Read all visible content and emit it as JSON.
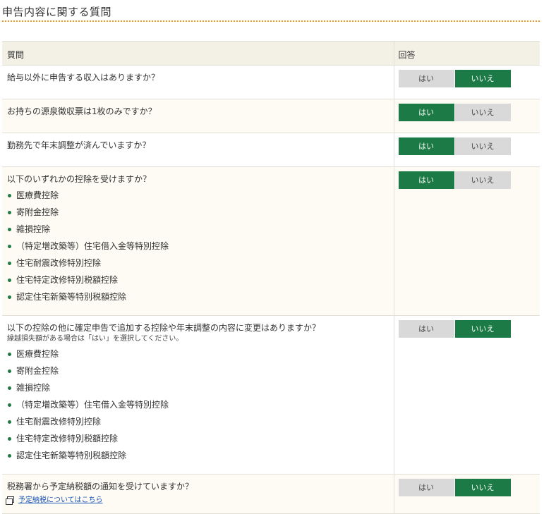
{
  "page_title": "申告内容に関する質問",
  "table": {
    "col_question": "質問",
    "col_answer": "回答"
  },
  "option_yes": "はい",
  "option_no": "いいえ",
  "questions": [
    {
      "text": "給与以外に申告する収入はありますか？",
      "answer": "no"
    },
    {
      "text": "お持ちの源泉徴収票は1枚のみですか？",
      "answer": "yes"
    },
    {
      "text": "勤務先で年末調整が済んでいますか？",
      "answer": "yes"
    },
    {
      "text": "以下のいずれかの控除を受けますか？",
      "answer": "yes",
      "bullets": [
        "医療費控除",
        "寄附金控除",
        "雑損控除",
        "（特定増改築等）住宅借入金等特別控除",
        "住宅耐震改修特別控除",
        "住宅特定改修特別税額控除",
        "認定住宅新築等特別税額控除"
      ]
    },
    {
      "text": "以下の控除の他に確定申告で追加する控除や年末調整の内容に変更はありますか？",
      "note": "繰越損失額がある場合は「はい」を選択してください。",
      "answer": "no",
      "bullets": [
        "医療費控除",
        "寄附金控除",
        "雑損控除",
        "（特定増改築等）住宅借入金等特別控除",
        "住宅耐震改修特別控除",
        "住宅特定改修特別税額控除",
        "認定住宅新築等特別税額控除"
      ]
    },
    {
      "text": "税務署から予定納税額の通知を受けていますか？",
      "answer": "no",
      "link": "予定納税についてはこちら",
      "link_icon": "external-window-icon"
    }
  ],
  "colors": {
    "selected": "#1c7a46",
    "unselected": "#d9d9d9",
    "bullet": "#1f7a44",
    "title_divider": "#e39a2b",
    "header_bg": "#f3f1e6",
    "row_alt_bg": "#fdfbf4",
    "link": "#1a55b8"
  }
}
